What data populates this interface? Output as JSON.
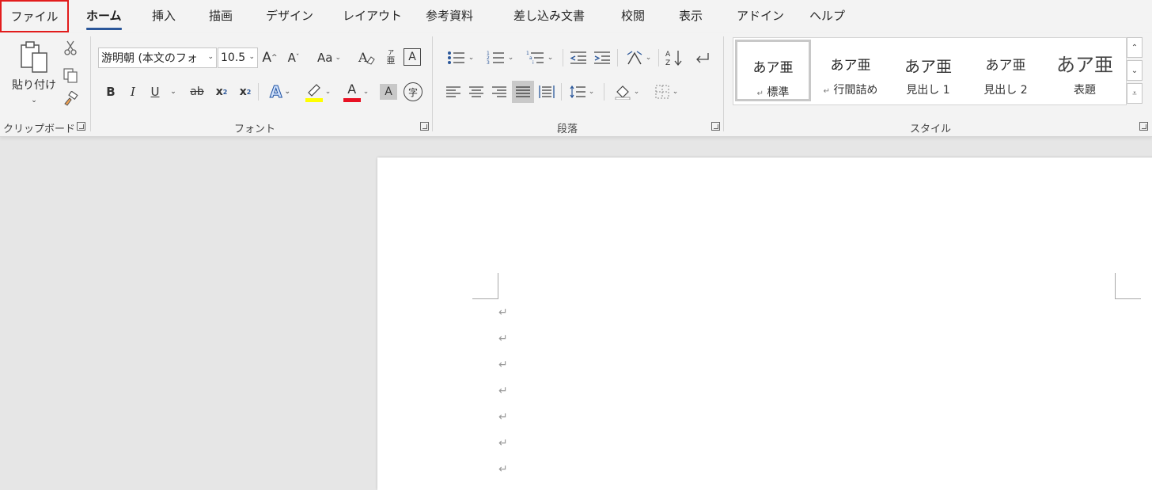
{
  "tabs": {
    "file": "ファイル",
    "home": "ホーム",
    "insert": "挿入",
    "draw": "描画",
    "design": "デザイン",
    "layout": "レイアウト",
    "references": "参考資料",
    "mailings": "差し込み文書",
    "review": "校閲",
    "view": "表示",
    "addins": "アドイン",
    "help": "ヘルプ"
  },
  "clipboard": {
    "paste_label": "貼り付け",
    "group_label": "クリップボード"
  },
  "font": {
    "name_value": "游明朝 (本文のフォ",
    "size_value": "10.5",
    "change_case": "Aa",
    "ruby_top": "ア",
    "ruby_bottom": "亜",
    "boxed_char": "A",
    "bold": "B",
    "italic": "I",
    "underline": "U",
    "strike": "ab",
    "subscript": "x",
    "superscript": "x",
    "sub_mark": "2",
    "sup_mark": "2",
    "text_effect": "A",
    "font_color": "A",
    "char_shading": "A",
    "enclose": "字",
    "group_label": "フォント",
    "highlight_color": "#ffff00",
    "font_color_bar": "#e81123"
  },
  "paragraph": {
    "group_label": "段落"
  },
  "styles": {
    "group_label": "スタイル",
    "items": [
      {
        "sample": "あア亜",
        "name": "標準",
        "mark": "↵"
      },
      {
        "sample": "あア亜",
        "name": "行間詰め",
        "mark": "↵"
      },
      {
        "sample": "あア亜",
        "name": "見出し 1",
        "mark": ""
      },
      {
        "sample": "あア亜",
        "name": "見出し 2",
        "mark": ""
      },
      {
        "sample": "あア亜",
        "name": "表題",
        "mark": ""
      }
    ]
  },
  "document": {
    "paragraph_mark": "↵"
  },
  "colors": {
    "accent": "#2b579a",
    "file_highlight": "#e21c1c"
  }
}
